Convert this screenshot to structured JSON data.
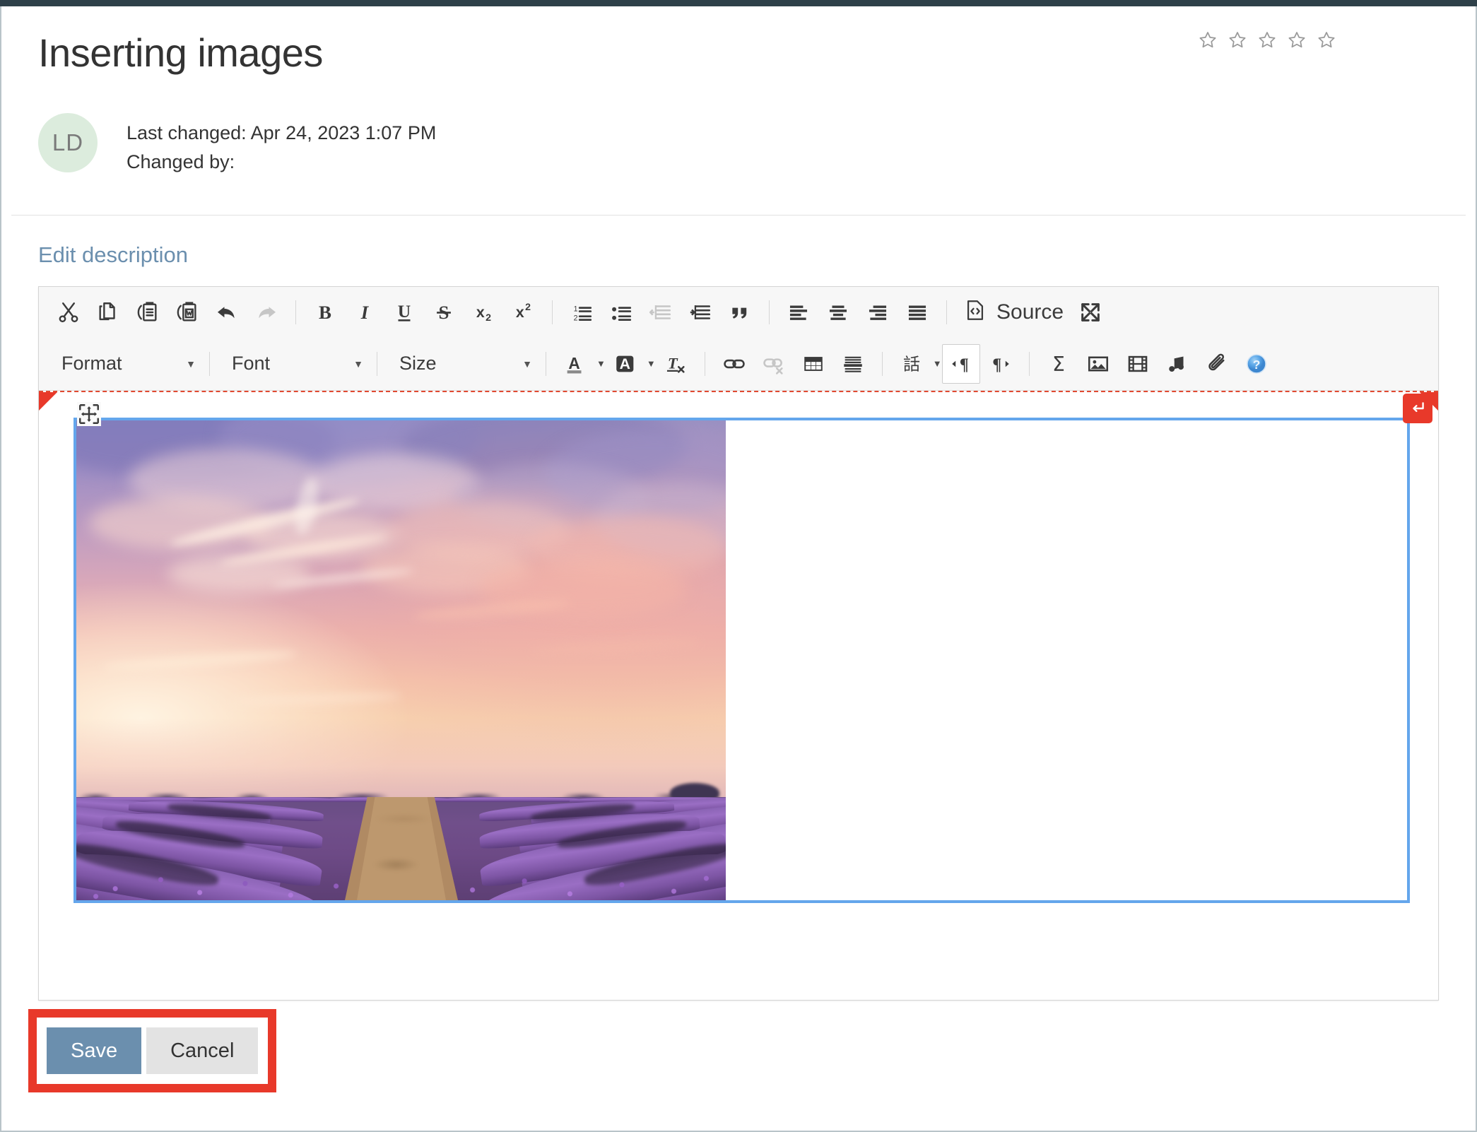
{
  "page": {
    "title": "Inserting images",
    "rating": {
      "name": "star-rating",
      "total": 5,
      "filled": 0
    }
  },
  "meta": {
    "avatar_initials": "LD",
    "last_changed_label": "Last changed: Apr 24, 2023 1:07 PM",
    "changed_by_label": "Changed by:"
  },
  "section": {
    "edit_description_label": "Edit description"
  },
  "toolbar": {
    "row1": [
      {
        "name": "cut-icon",
        "title": "Cut",
        "disabled": false
      },
      {
        "name": "copy-icon",
        "title": "Copy",
        "disabled": false
      },
      {
        "name": "paste-icon",
        "title": "Paste",
        "disabled": false
      },
      {
        "name": "paste-from-word-icon",
        "title": "Paste from Word",
        "disabled": false
      },
      {
        "name": "undo-icon",
        "title": "Undo",
        "disabled": false
      },
      {
        "name": "redo-icon",
        "title": "Redo",
        "disabled": true
      },
      {
        "name": "bold-icon",
        "title": "Bold",
        "disabled": false
      },
      {
        "name": "italic-icon",
        "title": "Italic",
        "disabled": false
      },
      {
        "name": "underline-icon",
        "title": "Underline",
        "disabled": false
      },
      {
        "name": "strikethrough-icon",
        "title": "Strikethrough",
        "disabled": false
      },
      {
        "name": "subscript-icon",
        "title": "Subscript",
        "disabled": false
      },
      {
        "name": "superscript-icon",
        "title": "Superscript",
        "disabled": false
      },
      {
        "name": "numbered-list-icon",
        "title": "Insert/Remove Numbered List",
        "disabled": false
      },
      {
        "name": "bulleted-list-icon",
        "title": "Insert/Remove Bulleted List",
        "disabled": false
      },
      {
        "name": "decrease-indent-icon",
        "title": "Decrease Indent",
        "disabled": true
      },
      {
        "name": "increase-indent-icon",
        "title": "Increase Indent",
        "disabled": false
      },
      {
        "name": "blockquote-icon",
        "title": "Block Quote",
        "disabled": false
      },
      {
        "name": "align-left-icon",
        "title": "Align Left",
        "disabled": false
      },
      {
        "name": "align-center-icon",
        "title": "Center",
        "disabled": false
      },
      {
        "name": "align-right-icon",
        "title": "Align Right",
        "disabled": false
      },
      {
        "name": "justify-icon",
        "title": "Justify",
        "disabled": false
      }
    ],
    "source_label": "Source",
    "source_icon": "source-code-icon",
    "maximize_icon": "maximize-icon",
    "row2": {
      "format_label": "Format",
      "font_label": "Font",
      "size_label": "Size",
      "buttons": [
        {
          "name": "text-color-icon",
          "title": "Text Color",
          "disabled": false
        },
        {
          "name": "background-color-icon",
          "title": "Background Color",
          "disabled": false
        },
        {
          "name": "remove-format-icon",
          "title": "Remove Format",
          "disabled": false
        },
        {
          "name": "link-icon",
          "title": "Link",
          "disabled": false
        },
        {
          "name": "unlink-icon",
          "title": "Unlink",
          "disabled": true
        },
        {
          "name": "table-icon",
          "title": "Table",
          "disabled": false
        },
        {
          "name": "horizontal-rule-icon",
          "title": "Horizontal Line",
          "disabled": false
        },
        {
          "name": "language-icon",
          "title": "Set Language",
          "disabled": false
        },
        {
          "name": "text-direction-ltr-icon",
          "title": "Text direction from left to right",
          "disabled": false,
          "active": true
        },
        {
          "name": "text-direction-rtl-icon",
          "title": "Text direction from right to left",
          "disabled": false
        },
        {
          "name": "math-icon",
          "title": "Math",
          "disabled": false
        },
        {
          "name": "insert-image-icon",
          "title": "Image",
          "disabled": false
        },
        {
          "name": "insert-video-icon",
          "title": "Video",
          "disabled": false
        },
        {
          "name": "insert-audio-icon",
          "title": "Audio",
          "disabled": false
        },
        {
          "name": "attachment-icon",
          "title": "Attachment",
          "disabled": false
        },
        {
          "name": "help-icon",
          "title": "About / Help",
          "disabled": false
        }
      ]
    }
  },
  "content": {
    "selected_image_alt": "Lavender field at sunset with rows converging toward the horizon and a dirt path",
    "drag_handle_icon": "move-handle-icon",
    "enter_badge_icon": "enter-return-icon"
  },
  "footer": {
    "save_label": "Save",
    "cancel_label": "Cancel"
  },
  "colors": {
    "topbar": "#2e4049",
    "accent_link": "#6b8fae",
    "save_button": "#6b8fae",
    "cancel_button": "#e3e3e3",
    "annotation_red": "#e8392a",
    "selection_blue": "#64a6ec",
    "avatar_bg": "#dcecdd"
  }
}
